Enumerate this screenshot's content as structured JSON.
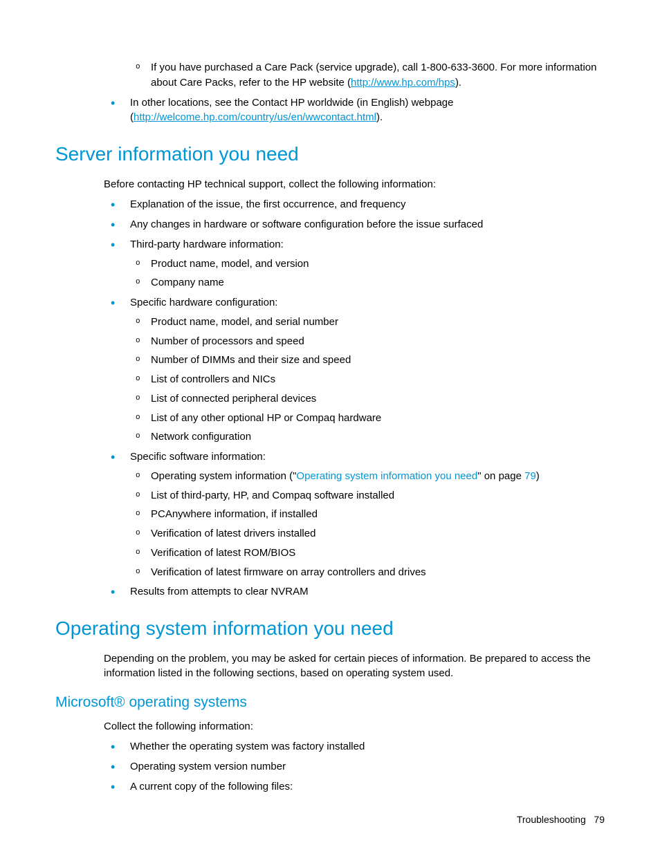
{
  "intro_list": {
    "sub_care_pack": {
      "prefix": "If you have purchased a Care Pack (service upgrade), call 1-800-633-3600. For more information about Care Packs, refer to the HP website (",
      "link": "http://www.hp.com/hps",
      "suffix": ")."
    },
    "other_locations": {
      "prefix": "In other locations, see the Contact HP worldwide (in English) webpage (",
      "link": "http://welcome.hp.com/country/us/en/wwcontact.html",
      "suffix": ")."
    }
  },
  "server_section": {
    "heading": "Server information you need",
    "intro": "Before contacting HP technical support, collect the following information:",
    "items": {
      "explanation": "Explanation of the issue, the first occurrence, and frequency",
      "changes": "Any changes in hardware or software configuration before the issue surfaced",
      "third_party": {
        "label": "Third-party hardware information:",
        "subs": [
          "Product name, model, and version",
          "Company name"
        ]
      },
      "hardware": {
        "label": "Specific hardware configuration:",
        "subs": [
          "Product name, model, and serial number",
          "Number of processors and speed",
          "Number of DIMMs and their size and speed",
          "List of controllers and NICs",
          "List of connected peripheral devices",
          "List of any other optional HP or Compaq hardware",
          "Network configuration"
        ]
      },
      "software": {
        "label": "Specific software information:",
        "os_sub": {
          "prefix": "Operating system information (\"",
          "xref": "Operating system information you need",
          "mid": "\" on page ",
          "page": "79",
          "suffix": ")"
        },
        "subs": [
          "List of third-party, HP, and Compaq software installed",
          "PCAnywhere information, if installed",
          "Verification of latest drivers installed",
          "Verification of latest ROM/BIOS",
          "Verification of latest firmware on array controllers and drives"
        ]
      },
      "nvram": "Results from attempts to clear NVRAM"
    }
  },
  "os_section": {
    "heading": "Operating system information you need",
    "intro": "Depending on the problem, you may be asked for certain pieces of information. Be prepared to access the information listed in the following sections, based on operating system used."
  },
  "ms_section": {
    "heading": "Microsoft® operating systems",
    "intro": "Collect the following information:",
    "items": [
      "Whether the operating system was factory installed",
      "Operating system version number",
      "A current copy of the following files:"
    ]
  },
  "footer": {
    "label": "Troubleshooting",
    "page": "79"
  }
}
